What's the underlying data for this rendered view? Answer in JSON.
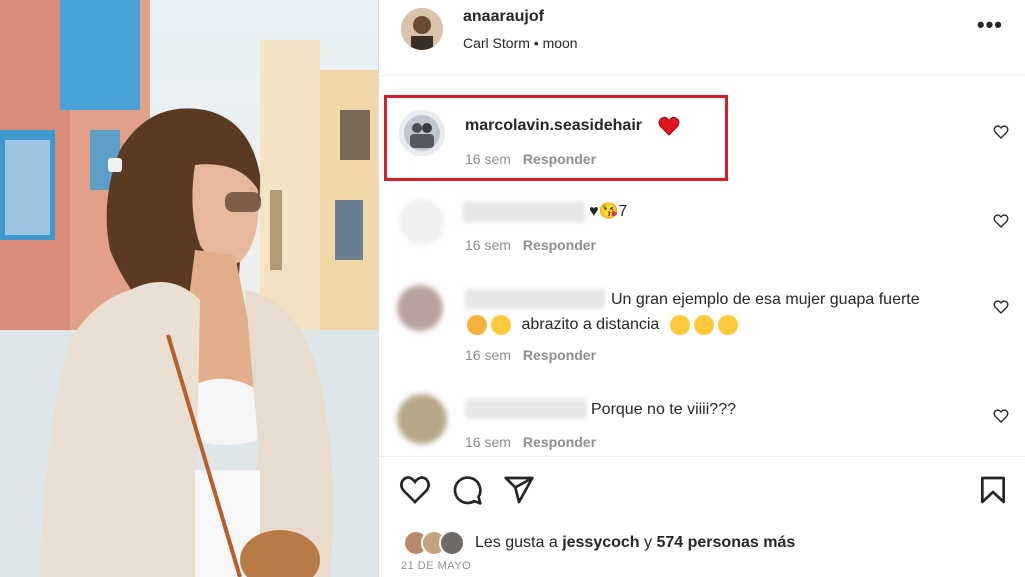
{
  "post": {
    "username": "anaaraujof",
    "music": "Carl Storm • moon"
  },
  "highlighted_comment": {
    "username": "marcolavin.seasidehair",
    "time": "16 sem",
    "reply": "Responder"
  },
  "comments": [
    {
      "text": "♥😘7",
      "time": "16 sem",
      "reply": "Responder"
    },
    {
      "text_line1": "Un gran ejemplo de esa mujer guapa fuerte",
      "text_line2": "abrazito a distancia",
      "time": "16 sem",
      "reply": "Responder"
    },
    {
      "text": "Porque no te viiii???",
      "time": "16 sem",
      "reply": "Responder"
    }
  ],
  "likes": {
    "prefix": "Les gusta a",
    "user": "jessycoch",
    "connector": "y",
    "others": "574 personas más"
  },
  "date": "21 DE MAYO",
  "colors": {
    "highlight": "#d1202c",
    "text": "#262626",
    "muted": "#8e8e8e"
  },
  "icons": [
    "heart-icon",
    "comment-icon",
    "share-icon",
    "bookmark-icon",
    "more-icon"
  ]
}
